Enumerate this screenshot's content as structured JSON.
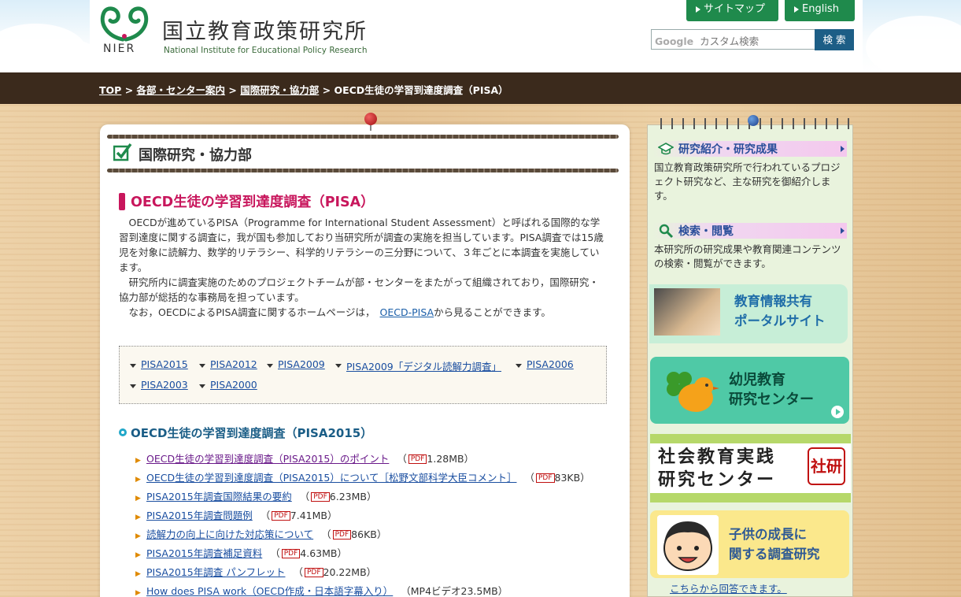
{
  "header": {
    "logo_text": "NIER",
    "title": "国立教育政策研究所",
    "subtitle": "National Institute for Educational Policy Research",
    "sitemap_label": "サイトマップ",
    "english_label": "English",
    "search_placeholder": "カスタム検索",
    "search_brand": "Google",
    "search_button": "検 索"
  },
  "breadcrumb": {
    "items": [
      "TOP",
      "各部・センター案内",
      "国際研究・協力部"
    ],
    "separator": ">",
    "current": "OECD生徒の学習到達度調査（PISA）"
  },
  "main": {
    "dept_title": "国際研究・協力部",
    "page_title": "OECD生徒の学習到達度調査（PISA）",
    "intro": {
      "p1": "OECDが進めているPISA（Programme for International Student Assessment）と呼ばれる国際的な学習到達度に関する調査に，我が国も参加しており当研究所が調査の実施を担当しています。PISA調査では15歳児を対象に読解力、数学的リテラシー、科学的リテラシーの三分野について、３年ごとに本調査を実施しています。",
      "p2": "研究所内に調査実施のためのプロジェクトチームが部・センターをまたがって組織されており，国際研究・協力部が総括的な事務局を担っています。",
      "p3_before": "なお，OECDによるPISA調査に関するホームページは，",
      "p3_link": "OECD-PISA",
      "p3_after": "から見ることができます。"
    },
    "year_links": [
      "PISA2015",
      "PISA2012",
      "PISA2009",
      "PISA2009「デジタル読解力調査」",
      "PISA2006",
      "PISA2003",
      "PISA2000"
    ],
    "section_title": "OECD生徒の学習到達度調査（PISA2015）",
    "pdf_label": "PDF",
    "documents": [
      {
        "title": "OECD生徒の学習到達度調査（PISA2015）のポイント",
        "size": "1.28MB）",
        "pdf": true
      },
      {
        "title": "OECD生徒の学習到達度調査（PISA2015）について［松野文部科学大臣コメント］",
        "size": "83KB）",
        "pdf": true
      },
      {
        "title": "PISA2015年調査国際結果の要約",
        "size": "6.23MB）",
        "pdf": true
      },
      {
        "title": "PISA2015年調査問題例",
        "size": "7.41MB）",
        "pdf": true
      },
      {
        "title": "読解力の向上に向けた対応策について",
        "size": "86KB）",
        "pdf": true
      },
      {
        "title": "PISA2015年調査補足資料",
        "size": "4.63MB）",
        "pdf": true
      },
      {
        "title": "PISA2015年調査 パンフレット",
        "size": "20.22MB）",
        "pdf": true
      },
      {
        "title": "How does PISA work（OECD作成・日本語字幕入り）",
        "size": "（MP4ビデオ23.5MB）",
        "pdf": false
      }
    ]
  },
  "sidebar": {
    "research_title": "研究紹介・研究成果",
    "research_text": "国立教育政策研究所で行われているプロジェクト研究など、主な研究を御紹介します。",
    "search_title": "検索・閲覧",
    "search_text": "本研究所の研究成果や教育関連コンテンツの検索・閲覧ができます。",
    "portal_banner": [
      "教育情報共有",
      "ポータルサイト"
    ],
    "early_banner": [
      "幼児教育",
      "研究センター"
    ],
    "social_banner": [
      "社会教育実践",
      "研究センター"
    ],
    "social_seal": "社研",
    "child_banner": [
      "子供の成長に",
      "関する調査研究"
    ],
    "child_link": "こちらから回答できます。"
  },
  "colors": {
    "accent_green": "#1f8a4c",
    "title_magenta": "#c8165c",
    "link_blue": "#1a4ea0",
    "breadcrumb_bg": "#3b2a1c"
  }
}
